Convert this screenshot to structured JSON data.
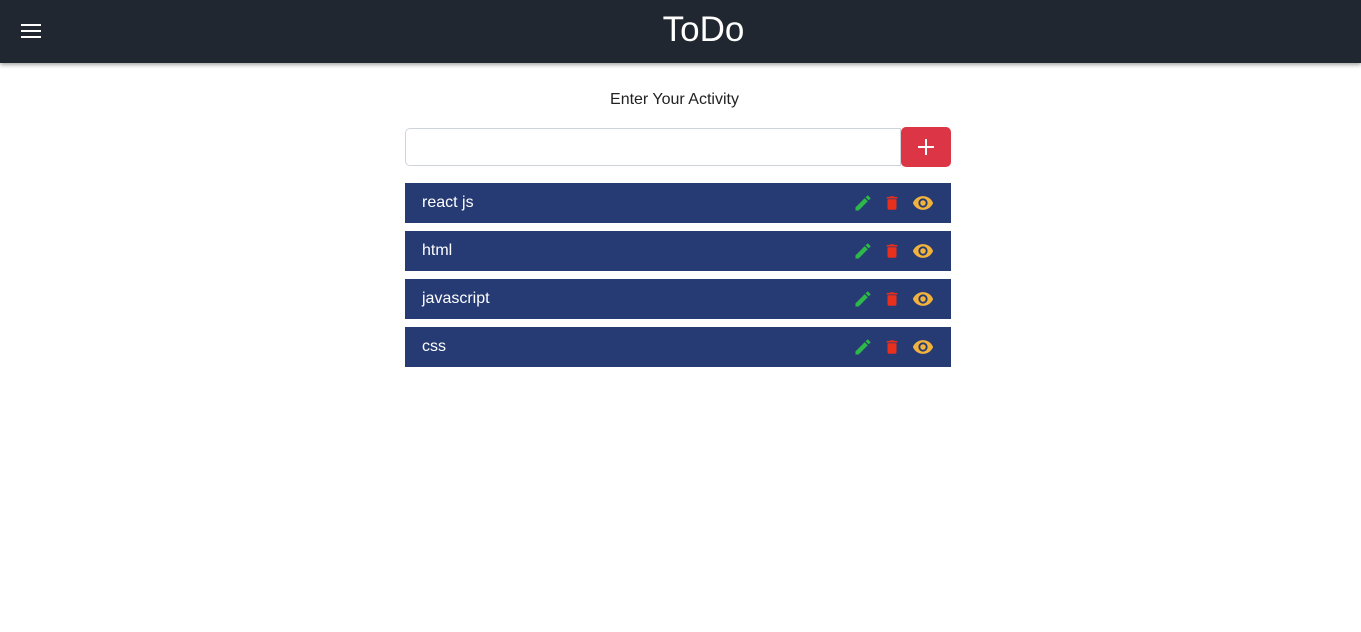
{
  "appbar": {
    "title": "ToDo",
    "menu_icon": "hamburger-menu-icon",
    "background": "#212730"
  },
  "form": {
    "prompt": "Enter Your Activity",
    "input_value": "",
    "input_placeholder": "",
    "add_icon": "plus-icon",
    "add_color": "#dc3545"
  },
  "todos": [
    {
      "text": "react js"
    },
    {
      "text": "html"
    },
    {
      "text": "javascript"
    },
    {
      "text": "css"
    }
  ],
  "item_actions": {
    "edit_icon": "pencil-icon",
    "delete_icon": "trash-icon",
    "view_icon": "eye-icon",
    "edit_color": "#2fb84a",
    "delete_color": "#e8301c",
    "view_color": "#f2b33d",
    "item_background": "#263a73"
  }
}
